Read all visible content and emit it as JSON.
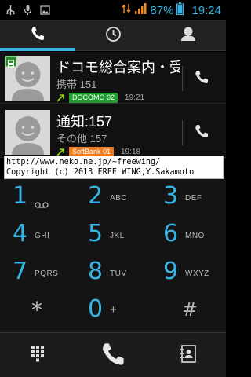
{
  "status_bar": {
    "battery_percent": "87%",
    "time": "19:24",
    "icons": [
      "usb-icon",
      "mic-icon",
      "image-icon",
      "data-arrows-icon",
      "signal-icon",
      "battery-icon"
    ],
    "accent": "#35b5e5"
  },
  "tabs": [
    {
      "name": "phone-icon",
      "selected": true
    },
    {
      "name": "clock-icon",
      "selected": false
    },
    {
      "name": "contact-icon",
      "selected": false
    }
  ],
  "call_log": [
    {
      "name": "ドコモ総合案内・受…",
      "number_type": "携帯 151",
      "carrier": "DOCOMO 02",
      "carrier_color": "#1f9e2e",
      "time": "19:21",
      "has_sim_badge": true
    },
    {
      "name": "通知:157",
      "number_type": "その他 157",
      "carrier": "SoftBank 01",
      "carrier_color": "#f07a1e",
      "time": "19:18",
      "has_sim_badge": false
    }
  ],
  "watermark": {
    "line1": "http://www.neko.ne.jp/~freewing/",
    "line2": "Copyright (c) 2013 FREE WING,Y.Sakamoto"
  },
  "dialpad": {
    "keys": [
      {
        "digit": "1",
        "letters": ""
      },
      {
        "digit": "2",
        "letters": "ABC"
      },
      {
        "digit": "3",
        "letters": "DEF"
      },
      {
        "digit": "4",
        "letters": "GHI"
      },
      {
        "digit": "5",
        "letters": "JKL"
      },
      {
        "digit": "6",
        "letters": "MNO"
      },
      {
        "digit": "7",
        "letters": "PQRS"
      },
      {
        "digit": "8",
        "letters": "TUV"
      },
      {
        "digit": "9",
        "letters": "WXYZ"
      },
      {
        "digit": "*",
        "letters": ""
      },
      {
        "digit": "0",
        "letters": "+"
      },
      {
        "digit": "#",
        "letters": ""
      }
    ],
    "digit_color": "#33b5e5"
  },
  "bottom_bar": {
    "icons": [
      "dialpad-grid-icon",
      "call-icon",
      "contact-card-icon"
    ]
  }
}
